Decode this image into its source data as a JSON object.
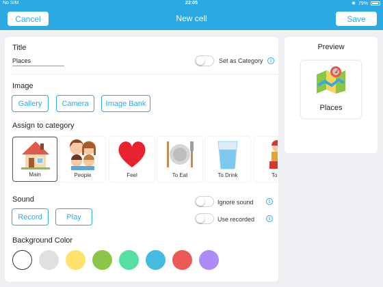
{
  "status": {
    "carrier": "No SIM",
    "time": "22:05",
    "battery": "79%"
  },
  "nav": {
    "cancel_label": "Cancel",
    "title": "New cell",
    "save_label": "Save"
  },
  "title_section": {
    "label": "Title",
    "value": "Places",
    "category_toggle_label": "Set as Category",
    "category_toggle_on": false
  },
  "image_section": {
    "label": "Image",
    "buttons": [
      "Gallery",
      "Camera",
      "Image Bank"
    ]
  },
  "assign_section": {
    "label": "Assign to category",
    "categories": [
      {
        "name": "Main",
        "icon": "house-icon",
        "selected": true
      },
      {
        "name": "People",
        "icon": "family-icon",
        "selected": false
      },
      {
        "name": "Feel",
        "icon": "heart-icon",
        "selected": false
      },
      {
        "name": "To Eat",
        "icon": "plate-icon",
        "selected": false
      },
      {
        "name": "To Drink",
        "icon": "glass-icon",
        "selected": false
      },
      {
        "name": "To P",
        "icon": "toy-icon",
        "selected": false
      }
    ]
  },
  "sound_section": {
    "label": "Sound",
    "buttons": [
      "Record",
      "Play"
    ],
    "ignore_sound_label": "Ignore sound",
    "use_recorded_label": "Use recorded",
    "ignore_sound_on": false,
    "use_recorded_on": false
  },
  "background_section": {
    "label": "Background Color",
    "colors": [
      "#ffffff",
      "#e0e0e0",
      "#fde36b",
      "#8cc646",
      "#57dfa0",
      "#44bbe0",
      "#ec5a56",
      "#b08af6"
    ],
    "selected_index": 0
  },
  "preview": {
    "label": "Preview",
    "cell_text": "Places",
    "icon": "map-icon"
  },
  "colors": {
    "accent": "#2aa9e4"
  }
}
